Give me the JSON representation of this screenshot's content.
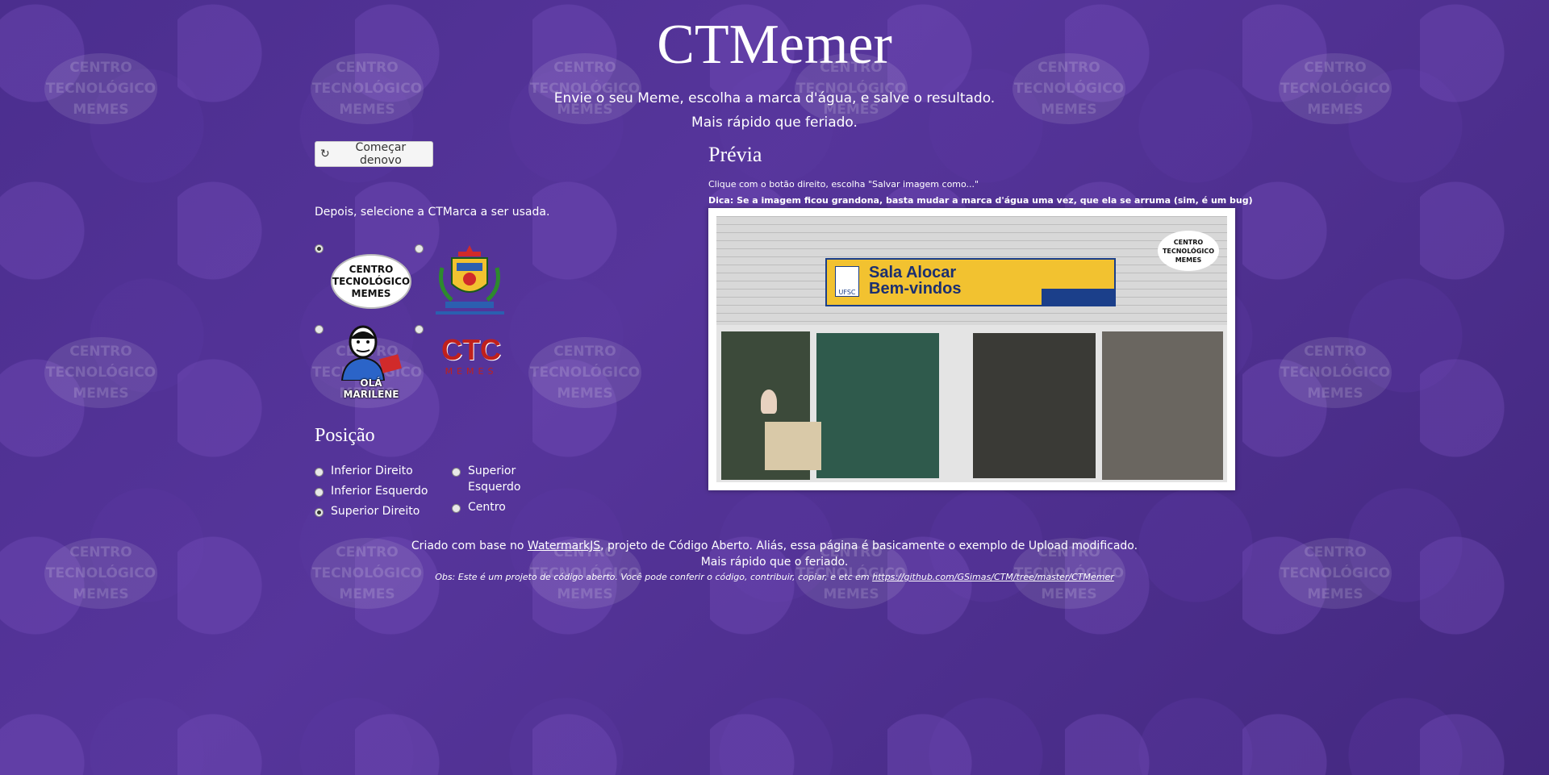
{
  "header": {
    "title": "CTMemer",
    "subtitle_line1": "Envie o seu Meme, escolha a marca d'água, e salve o resultado.",
    "subtitle_line2": "Mais rápido que feriado."
  },
  "controls": {
    "restart_button": "Começar denovo",
    "restart_icon": "refresh-icon",
    "select_label": "Depois, selecione a CTMarca a ser usada.",
    "marks": [
      {
        "name": "centro-tecnologico-memes",
        "lines": [
          "CENTRO",
          "TECNOLÓGICO",
          "MEMES"
        ],
        "selected": true
      },
      {
        "name": "ufsc-coat-of-arms",
        "selected": false
      },
      {
        "name": "ola-marilene",
        "text": "OLÁ MARILENE",
        "selected": false
      },
      {
        "name": "ctc-memes",
        "text": "CTC",
        "subtext": "MEMES",
        "selected": false
      }
    ]
  },
  "position": {
    "heading": "Posição",
    "options": [
      {
        "label": "Inferior Direito",
        "selected": false
      },
      {
        "label": "Inferior Esquerdo",
        "selected": false
      },
      {
        "label": "Superior Direito",
        "selected": true
      },
      {
        "label": "Superior Esquerdo",
        "selected": false
      },
      {
        "label": "Centro",
        "selected": false
      }
    ]
  },
  "preview": {
    "heading": "Prévia",
    "hint": "Clique com o botão direito, escolha \"Salvar imagem como...\"",
    "tip": "Dica: Se a imagem ficou grandona, basta mudar a marca d'água uma vez, que ela se arruma (sim, é um bug)",
    "sign_title": "Sala Alocar",
    "sign_subtitle": "Bem-vindos",
    "sign_logo": "UFSC",
    "watermark_lines": [
      "CENTRO",
      "TECNOLÓGICO",
      "MEMES"
    ]
  },
  "background_watermark": [
    "CENTRO",
    "TECNOLÓGICO",
    "MEMES"
  ],
  "footer": {
    "line1_prefix": "Criado com base no ",
    "line1_link": "WatermarkJS",
    "line1_suffix": ", projeto de Código Aberto. Aliás, essa página é basicamente o exemplo de Upload modificado.",
    "line2": "Mais rápido que o feriado.",
    "line3_prefix": "Obs: Este é um projeto de código aberto. Você pode conferir o código, contribuir, copiar, e etc em ",
    "line3_link": "https://github.com/GSimas/CTM/tree/master/CTMemer"
  },
  "colors": {
    "background": "#4a2d8a",
    "sign_yellow": "#f2c230",
    "ctc_red": "#c0201c"
  }
}
